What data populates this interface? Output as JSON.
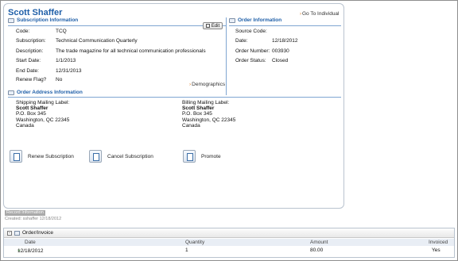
{
  "header": {
    "title": "Scott Shaffer",
    "go_to_individual": "Go To Individual"
  },
  "subscription": {
    "heading": "Subscription Information",
    "edit_label": "Edit",
    "fields": [
      {
        "label": "Code:",
        "value": "TCQ"
      },
      {
        "label": "Subscription:",
        "value": "Technical Communication Quarterly"
      },
      {
        "label": "Description:",
        "value": "The trade magazine for all technical communication professionals"
      },
      {
        "label": "Start Date:",
        "value": "1/1/2013"
      },
      {
        "label": "End Date:",
        "value": "12/31/2013"
      },
      {
        "label": "Renew Flag?",
        "value": "No"
      }
    ],
    "demographics_link": "Demographics"
  },
  "order": {
    "heading": "Order Information",
    "fields": [
      {
        "label": "Source Code:",
        "value": ""
      },
      {
        "label": "Date:",
        "value": "12/18/2012"
      },
      {
        "label": "Order Number:",
        "value": "003930"
      },
      {
        "label": "Order Status:",
        "value": "Closed"
      }
    ]
  },
  "address": {
    "heading": "Order Address Information",
    "shipping": {
      "label": "Shipping Mailing Label:",
      "name": "Scott Shaffer",
      "line1": "P.O. Box 345",
      "line2": "Washington, QC 22345",
      "line3": "Canada"
    },
    "billing": {
      "label": "Billing Mailing Label:",
      "name": "Scott Shaffer",
      "line1": "P.O. Box 345",
      "line2": "Washington, QC 22345",
      "line3": "Canada"
    }
  },
  "actions": {
    "renew": "Renew Subscription",
    "cancel": "Cancel Subscription",
    "promote": "Promote"
  },
  "record": {
    "badge": "Record Information",
    "created": "Created: sshaffer 12/18/2012"
  },
  "order_grid": {
    "title": "Order/Invoice",
    "columns": [
      "Date",
      "Quantity",
      "Amount",
      "Invoiced"
    ],
    "rows": [
      {
        "date": "12/18/2012",
        "quantity": "1",
        "amount": "80.00",
        "invoiced": "Yes"
      }
    ]
  },
  "colors": {
    "accent": "#1f5fa8",
    "link_arrow": "#e07a1e",
    "rule": "#7fa6d2"
  }
}
